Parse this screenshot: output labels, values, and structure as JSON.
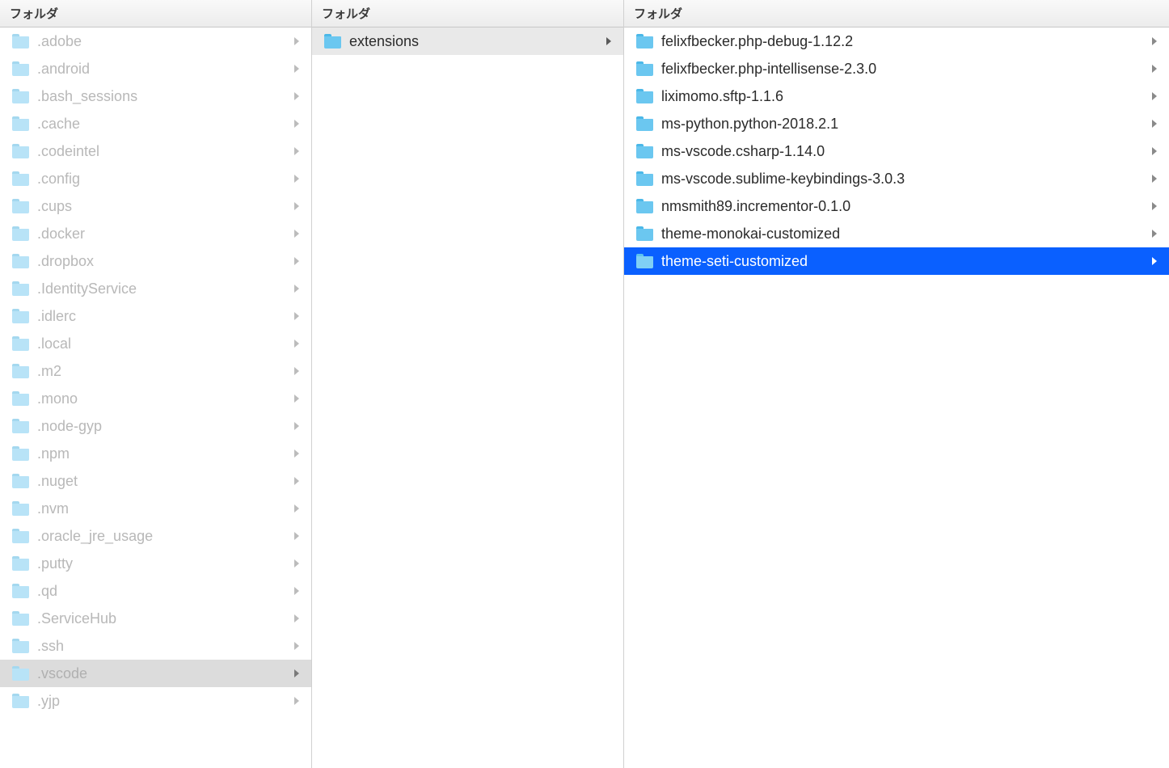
{
  "columns": [
    {
      "header": "フォルダ",
      "items": [
        {
          "name": ".adobe",
          "state": "dimmed"
        },
        {
          "name": ".android",
          "state": "dimmed"
        },
        {
          "name": ".bash_sessions",
          "state": "dimmed"
        },
        {
          "name": ".cache",
          "state": "dimmed"
        },
        {
          "name": ".codeintel",
          "state": "dimmed"
        },
        {
          "name": ".config",
          "state": "dimmed"
        },
        {
          "name": ".cups",
          "state": "dimmed"
        },
        {
          "name": ".docker",
          "state": "dimmed"
        },
        {
          "name": ".dropbox",
          "state": "dimmed"
        },
        {
          "name": ".IdentityService",
          "state": "dimmed"
        },
        {
          "name": ".idlerc",
          "state": "dimmed"
        },
        {
          "name": ".local",
          "state": "dimmed"
        },
        {
          "name": ".m2",
          "state": "dimmed"
        },
        {
          "name": ".mono",
          "state": "dimmed"
        },
        {
          "name": ".node-gyp",
          "state": "dimmed"
        },
        {
          "name": ".npm",
          "state": "dimmed"
        },
        {
          "name": ".nuget",
          "state": "dimmed"
        },
        {
          "name": ".nvm",
          "state": "dimmed"
        },
        {
          "name": ".oracle_jre_usage",
          "state": "dimmed"
        },
        {
          "name": ".putty",
          "state": "dimmed"
        },
        {
          "name": ".qd",
          "state": "dimmed"
        },
        {
          "name": ".ServiceHub",
          "state": "dimmed"
        },
        {
          "name": ".ssh",
          "state": "dimmed"
        },
        {
          "name": ".vscode",
          "state": "selected-inactive"
        },
        {
          "name": ".yjp",
          "state": "dimmed"
        }
      ]
    },
    {
      "header": "フォルダ",
      "items": [
        {
          "name": "extensions",
          "state": "browsed"
        }
      ]
    },
    {
      "header": "フォルダ",
      "items": [
        {
          "name": "felixfbecker.php-debug-1.12.2",
          "state": "normal"
        },
        {
          "name": "felixfbecker.php-intellisense-2.3.0",
          "state": "normal"
        },
        {
          "name": "liximomo.sftp-1.1.6",
          "state": "normal"
        },
        {
          "name": "ms-python.python-2018.2.1",
          "state": "normal"
        },
        {
          "name": "ms-vscode.csharp-1.14.0",
          "state": "normal"
        },
        {
          "name": "ms-vscode.sublime-keybindings-3.0.3",
          "state": "normal"
        },
        {
          "name": "nmsmith89.incrementor-0.1.0",
          "state": "normal"
        },
        {
          "name": "theme-monokai-customized",
          "state": "normal"
        },
        {
          "name": "theme-seti-customized",
          "state": "selected-active"
        }
      ]
    }
  ]
}
